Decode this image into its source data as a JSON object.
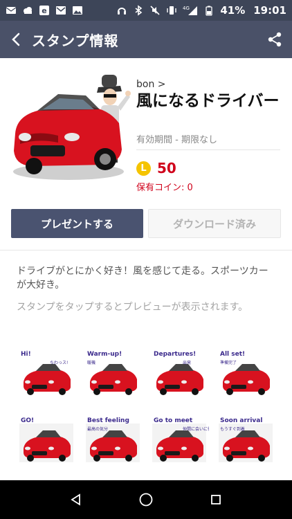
{
  "status_bar": {
    "network": "4G",
    "battery": "41%",
    "time": "19:01"
  },
  "header": {
    "title": "スタンプ情報"
  },
  "product": {
    "creator": "bon >",
    "title": "風になるドライバー",
    "validity": "有効期間 - 期限なし",
    "coin_icon_letter": "L",
    "price": "50",
    "coins_owned": "保有コイン: 0"
  },
  "buttons": {
    "present": "プレゼントする",
    "downloaded": "ダウンロード済み"
  },
  "description": "ドライブがとにかく好き！風を感じて走る。スポーツカーが大好き。",
  "preview_hint": "スタンプをタップするとプレビューが表示されます。",
  "stickers": [
    {
      "text": "Hi!",
      "sub": "ちわっス!"
    },
    {
      "text": "Warm-up!",
      "sub": "暖機"
    },
    {
      "text": "Departures!",
      "sub": "出発"
    },
    {
      "text": "All set!",
      "sub": "準備完了"
    },
    {
      "text": "GO!",
      "sub": ""
    },
    {
      "text": "Best feeling",
      "sub": "最高の気分"
    },
    {
      "text": "Go to meet",
      "sub": "仲間に会いに行く"
    },
    {
      "text": "Soon arrival",
      "sub": "もうすぐ到着"
    }
  ],
  "colors": {
    "header_bg": "#4a5168",
    "status_bg": "#3d4558",
    "present_button": "#4a5370",
    "price_red": "#d0021b",
    "coin_yellow": "#f5c400"
  }
}
